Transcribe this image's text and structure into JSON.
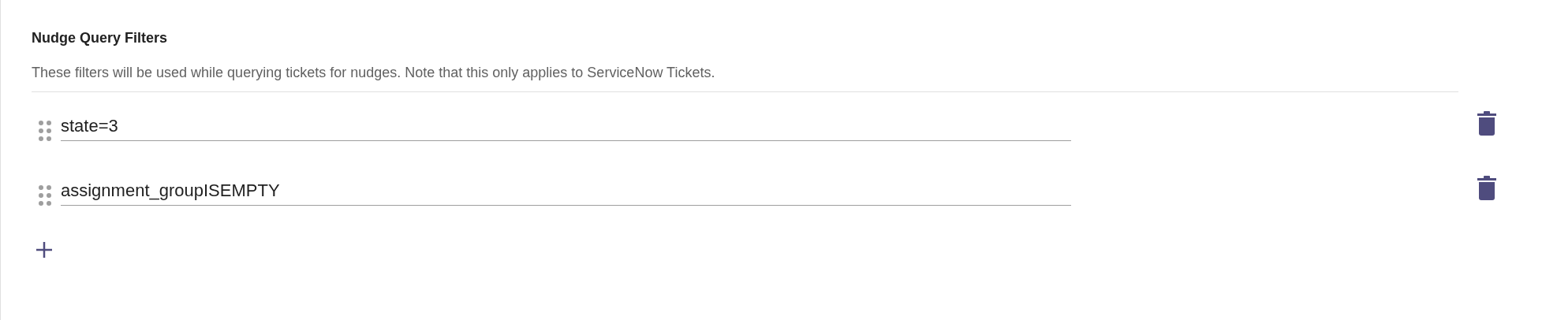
{
  "section": {
    "title": "Nudge Query Filters",
    "description": "These filters will be used while querying tickets for nudges. Note that this only applies to ServiceNow Tickets."
  },
  "filters": [
    {
      "value": "state=3"
    },
    {
      "value": "assignment_groupISEMPTY"
    }
  ]
}
